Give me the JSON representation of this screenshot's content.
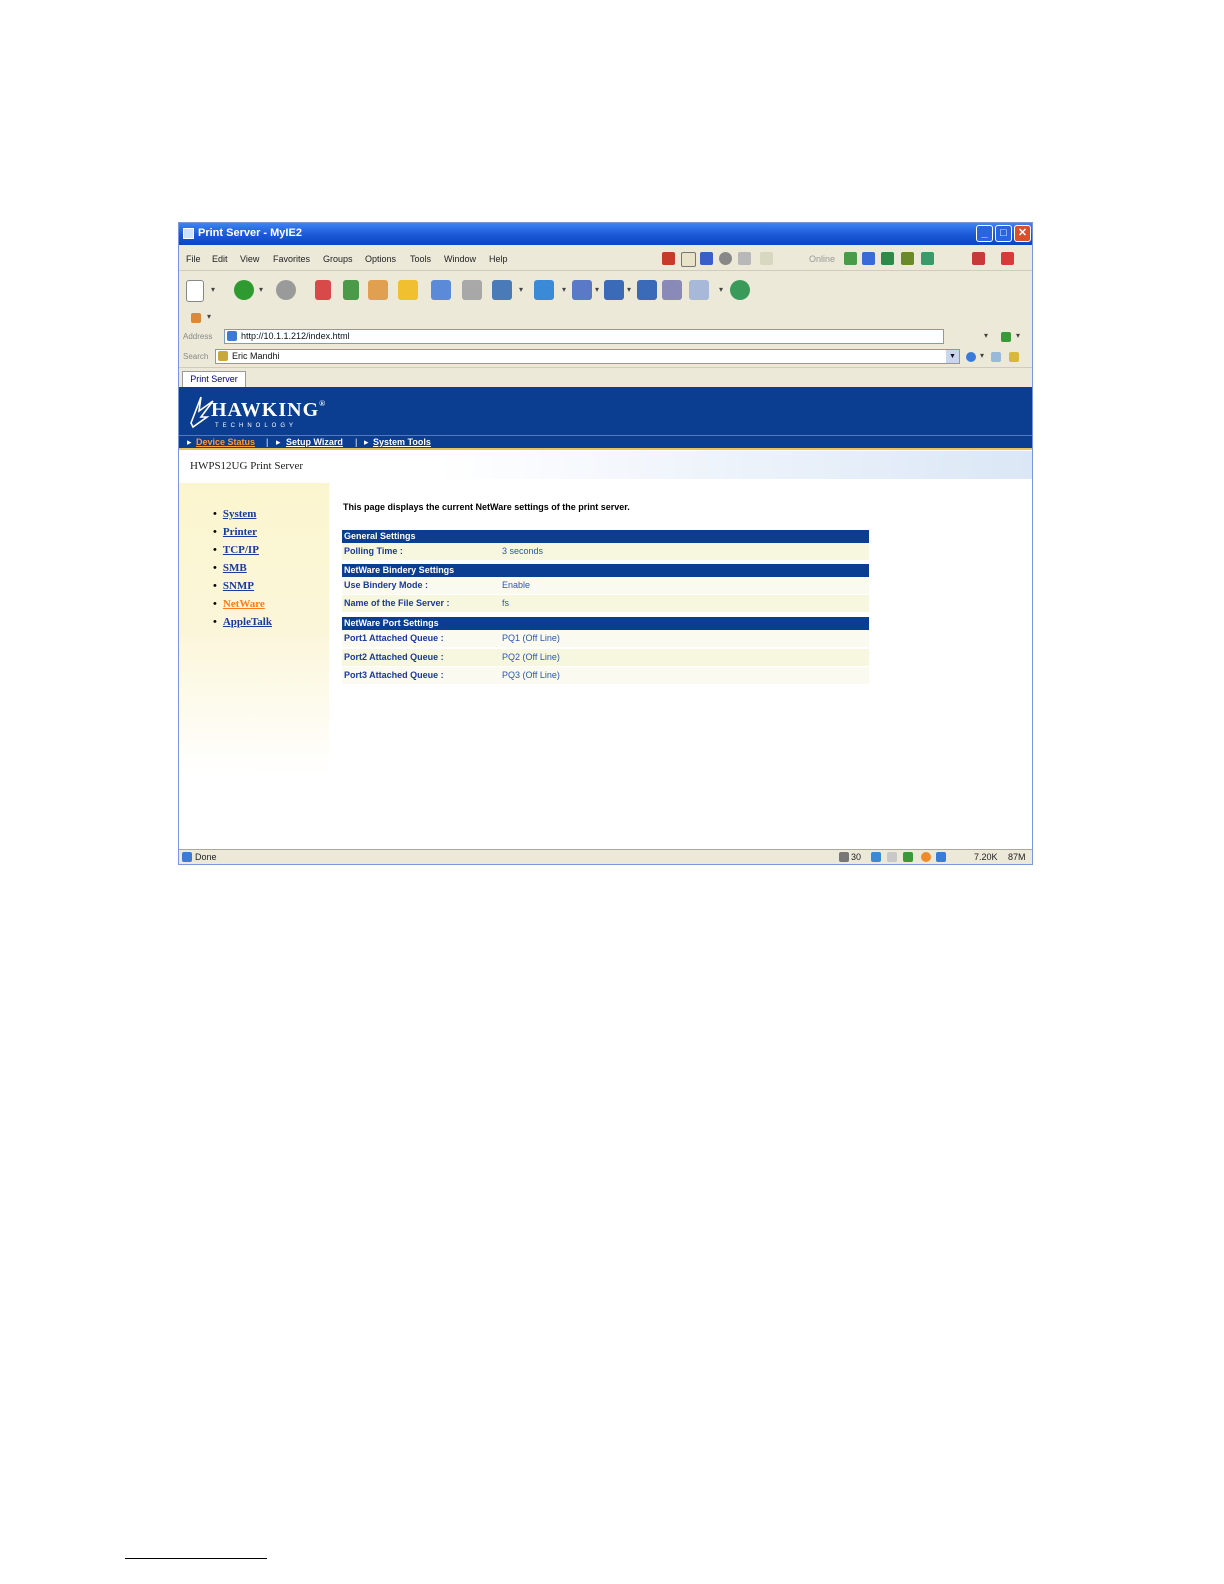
{
  "window": {
    "title": "Print Server - MyIE2",
    "minimize": "_",
    "maximize": "□",
    "close": "✕"
  },
  "menu": {
    "items": [
      "File",
      "Edit",
      "View",
      "Favorites",
      "Groups",
      "Options",
      "Tools",
      "Window",
      "Help"
    ],
    "online_label": "Online"
  },
  "address": {
    "label": "Address",
    "value": "http://10.1.1.212/index.html"
  },
  "search": {
    "label": "Search",
    "value": "Eric Mandhi"
  },
  "doc_tab": {
    "label": "Print Server"
  },
  "header": {
    "brand": "HAWKING",
    "tagline": "TECHNOLOGY"
  },
  "nav": {
    "items": [
      {
        "label": "Device Status"
      },
      {
        "label": "Setup Wizard"
      },
      {
        "label": "System Tools"
      }
    ],
    "separator": "|"
  },
  "subtitle": "HWPS12UG Print Server",
  "sidebar": {
    "items": [
      {
        "label": "System"
      },
      {
        "label": "Printer"
      },
      {
        "label": "TCP/IP"
      },
      {
        "label": "SMB"
      },
      {
        "label": "SNMP"
      },
      {
        "label": "NetWare"
      },
      {
        "label": "AppleTalk"
      }
    ]
  },
  "content": {
    "intro": "This page displays the current NetWare settings of the print server.",
    "sections": [
      {
        "title": "General Settings",
        "rows": [
          {
            "label": "Polling Time :",
            "value": "3 seconds"
          }
        ]
      },
      {
        "title": "NetWare Bindery Settings",
        "rows": [
          {
            "label": "Use Bindery Mode :",
            "value": "Enable"
          },
          {
            "label": "Name of the File Server :",
            "value": "fs"
          }
        ]
      },
      {
        "title": "NetWare Port Settings",
        "rows": [
          {
            "label": "Port1 Attached Queue :",
            "value": "PQ1 (Off Line)"
          },
          {
            "label": "Port2 Attached Queue :",
            "value": "PQ2 (Off Line)"
          },
          {
            "label": "Port3 Attached Queue :",
            "value": "PQ3 (Off Line)"
          }
        ]
      }
    ]
  },
  "status": {
    "text": "Done",
    "count": "30",
    "size": "7.20K",
    "mem": "87M"
  },
  "colors": {
    "header_blue": "#0b3d91",
    "link_blue": "#1a3a9c",
    "active_orange": "#ff7b1a",
    "sidebar_cream": "#fbf5cf"
  }
}
